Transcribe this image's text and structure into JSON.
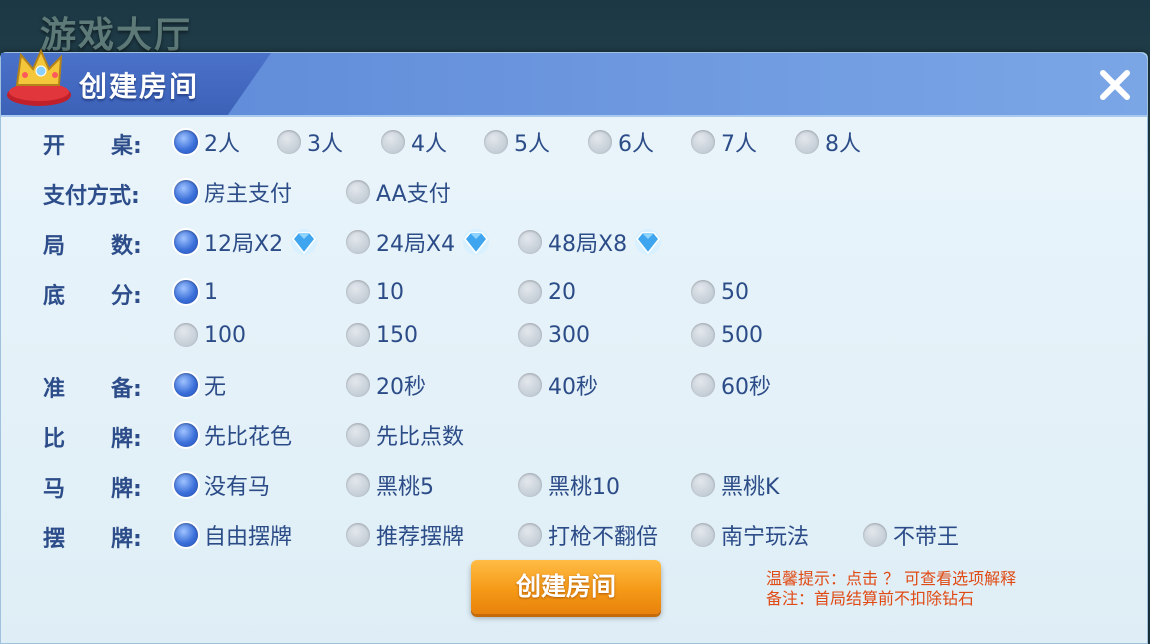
{
  "background_title": "游戏大厅",
  "dialog": {
    "title": "创建房间",
    "close_label": "✕"
  },
  "rows": [
    {
      "label": "开桌:",
      "label_a": "开",
      "label_b": "桌:",
      "options": [
        "2人",
        "3人",
        "4人",
        "5人",
        "6人",
        "7人",
        "8人"
      ],
      "selected": 0
    },
    {
      "label": "支付方式:",
      "options": [
        "房主支付",
        "AA支付"
      ],
      "selected": 0
    },
    {
      "label": "局数:",
      "label_a": "局",
      "label_b": "数:",
      "options": [
        "12局X2",
        "24局X4",
        "48局X8"
      ],
      "selected": 0,
      "icon": "diamond-icon"
    },
    {
      "label": "底分:",
      "label_a": "底",
      "label_b": "分:",
      "options": [
        "1",
        "10",
        "20",
        "50"
      ],
      "options2": [
        "100",
        "150",
        "300",
        "500"
      ],
      "selected": 0
    },
    {
      "label": "准备:",
      "label_a": "准",
      "label_b": "备:",
      "options": [
        "无",
        "20秒",
        "40秒",
        "60秒"
      ],
      "selected": 0
    },
    {
      "label": "比牌:",
      "label_a": "比",
      "label_b": "牌:",
      "options": [
        "先比花色",
        "先比点数"
      ],
      "selected": 0
    },
    {
      "label": "马牌:",
      "label_a": "马",
      "label_b": "牌:",
      "options": [
        "没有马",
        "黑桃5",
        "黑桃10",
        "黑桃K"
      ],
      "selected": 0
    },
    {
      "label": "摆牌:",
      "label_a": "摆",
      "label_b": "牌:",
      "options": [
        "自由摆牌",
        "推荐摆牌",
        "打枪不翻倍",
        "南宁玩法",
        "不带王"
      ],
      "selected": 0
    }
  ],
  "create_button": "创建房间",
  "tips": {
    "line1": "温馨提示：点击 ？ 可查看选项解释",
    "line2": "备注：首局结算前不扣除钻石"
  },
  "colors": {
    "accent": "#3b6fd9",
    "label": "#2d4d8a",
    "button": "#f59a17",
    "tip": "#e04a14"
  }
}
